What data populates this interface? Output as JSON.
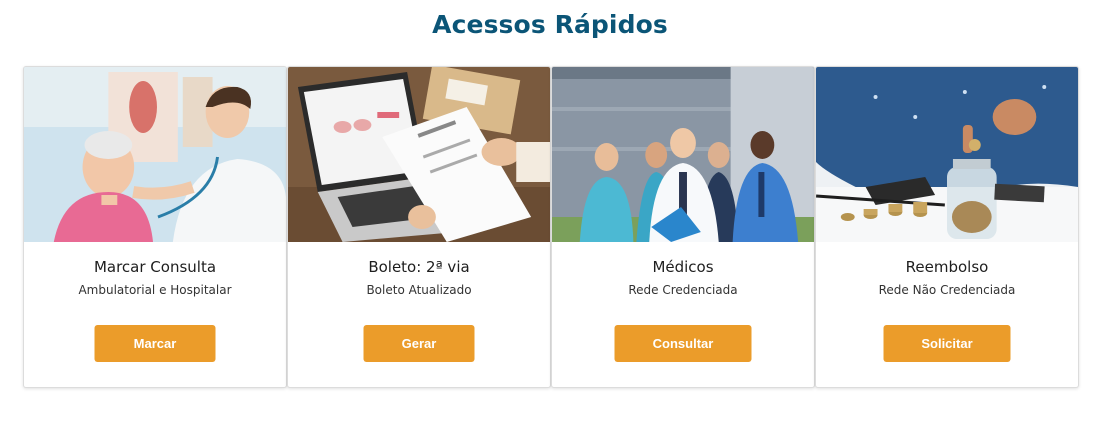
{
  "section": {
    "title": "Acessos Rápidos"
  },
  "colors": {
    "title": "#0b5577",
    "button": "#eb9c2a",
    "button_text": "#ffffff"
  },
  "cards": [
    {
      "image": "doctor-with-elderly-patient-photo",
      "title": "Marcar Consulta",
      "subtitle": "Ambulatorial e Hospitalar",
      "button": "Marcar"
    },
    {
      "image": "laptop-and-invoice-photo",
      "title": "Boleto: 2ª via",
      "subtitle": "Boleto Atualizado",
      "button": "Gerar"
    },
    {
      "image": "medical-team-photo",
      "title": "Médicos",
      "subtitle": "Rede Credenciada",
      "button": "Consultar"
    },
    {
      "image": "coins-jar-calculator-photo",
      "title": "Reembolso",
      "subtitle": "Rede Não Credenciada",
      "button": "Solicitar"
    }
  ]
}
